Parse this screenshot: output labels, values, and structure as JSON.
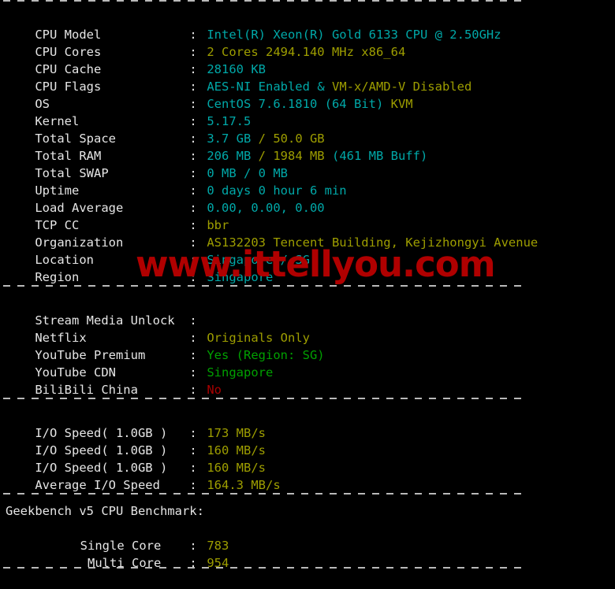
{
  "terminal": {
    "watermark": "www.ittellyou.com",
    "colors": {
      "background": "#000000",
      "label": "#e6e6e6",
      "cyan": "#00a8a8",
      "yellow": "#9e9e00",
      "green": "#00a000",
      "red": "#a80000",
      "separator": "#b9b9b9",
      "watermark": "#b00000"
    },
    "separator_char": "-"
  },
  "system_info": {
    "rows": [
      {
        "label": "CPU Model",
        "colon": ":",
        "value": "Intel(R) Xeon(R) Gold 6133 CPU @ 2.50GHz",
        "color": "cyan"
      },
      {
        "label": "CPU Cores",
        "colon": ":",
        "value": "2 Cores 2494.140 MHz x86_64",
        "color": "yellow"
      },
      {
        "label": "CPU Cache",
        "colon": ":",
        "value": "28160 KB",
        "color": "cyan"
      },
      {
        "label": "CPU Flags",
        "colon": ":",
        "value": "AES-NI Enabled & VM-x/AMD-V Disabled",
        "color": "mixed"
      },
      {
        "label": "OS",
        "colon": ":",
        "value": "CentOS 7.6.1810 (64 Bit) KVM",
        "color": "mixed"
      },
      {
        "label": "Kernel",
        "colon": ":",
        "value": "5.17.5",
        "color": "cyan"
      },
      {
        "label": "Total Space",
        "colon": ":",
        "value": "3.7 GB / 50.0 GB",
        "color": "mixed"
      },
      {
        "label": "Total RAM",
        "colon": ":",
        "value": "206 MB / 1984 MB (461 MB Buff)",
        "color": "mixed"
      },
      {
        "label": "Total SWAP",
        "colon": ":",
        "value": "0 MB / 0 MB",
        "color": "cyan"
      },
      {
        "label": "Uptime",
        "colon": ":",
        "value": "0 days 0 hour 6 min",
        "color": "cyan"
      },
      {
        "label": "Load Average",
        "colon": ":",
        "value": "0.00, 0.00, 0.00",
        "color": "cyan"
      },
      {
        "label": "TCP CC",
        "colon": ":",
        "value": "bbr",
        "color": "yellow"
      },
      {
        "label": "Organization",
        "colon": ":",
        "value": "AS132203 Tencent Building, Kejizhongyi Avenue",
        "color": "yellow"
      },
      {
        "label": "Location",
        "colon": ":",
        "value": "Singapore / SG",
        "color": "cyan"
      },
      {
        "label": "Region",
        "colon": ":",
        "value": "Singapore",
        "color": "cyan"
      }
    ],
    "cpu_flags_parts": {
      "aes": "AES-NI Enabled ",
      "amp": "& ",
      "vm": "VM-x/AMD-V Disabled"
    },
    "os_parts": {
      "distro": "CentOS 7.6.1810 (64 Bit) ",
      "virt": "KVM"
    },
    "space_parts": {
      "used": "3.7 GB ",
      "total": "/ 50.0 GB"
    },
    "ram_parts": {
      "used": "206 MB ",
      "total": "/ 1984 MB ",
      "buff": "(461 MB Buff)"
    }
  },
  "stream_media": {
    "header_label": "Stream Media Unlock",
    "header_colon": ":",
    "rows": [
      {
        "label": "Netflix",
        "colon": ":",
        "value": "Originals Only",
        "color": "yellow"
      },
      {
        "label": "YouTube Premium",
        "colon": ":",
        "value": "Yes (Region: SG)",
        "color": "green"
      },
      {
        "label": "YouTube CDN",
        "colon": ":",
        "value": "Singapore",
        "color": "green"
      },
      {
        "label": "BiliBili China",
        "colon": ":",
        "value": "No",
        "color": "red"
      }
    ]
  },
  "io_speed": {
    "rows": [
      {
        "label": "I/O Speed( 1.0GB )",
        "colon": ":",
        "value": "173 MB/s",
        "color": "yellow"
      },
      {
        "label": "I/O Speed( 1.0GB )",
        "colon": ":",
        "value": "160 MB/s",
        "color": "yellow"
      },
      {
        "label": "I/O Speed( 1.0GB )",
        "colon": ":",
        "value": "160 MB/s",
        "color": "yellow"
      },
      {
        "label": "Average I/O Speed",
        "colon": ":",
        "value": "164.3 MB/s",
        "color": "yellow"
      }
    ]
  },
  "geekbench": {
    "title": "Geekbench v5 CPU Benchmark:",
    "rows": [
      {
        "label": "Single Core",
        "colon": ":",
        "value": "783",
        "color": "yellow"
      },
      {
        "label": "Multi Core",
        "colon": ":",
        "value": "954",
        "color": "yellow"
      }
    ]
  }
}
